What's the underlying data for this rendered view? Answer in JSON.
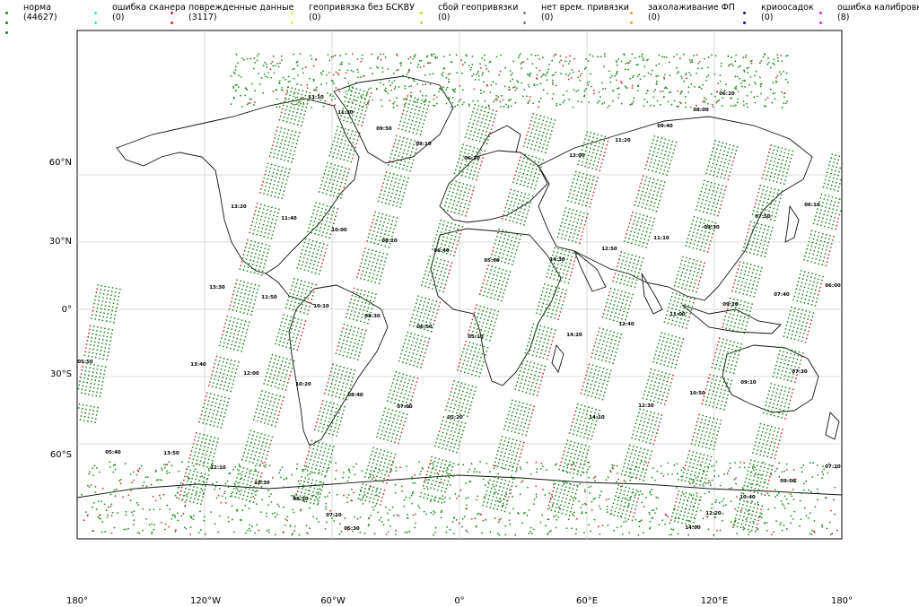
{
  "legend": [
    {
      "label": "норма",
      "count": "(44627)",
      "color": "#1a7a1a"
    },
    {
      "label": "ошибка сканера",
      "count": "(0)",
      "color": "#33e0e0"
    },
    {
      "label": "поврежденные данные",
      "count": "(3117)",
      "color": "#e02020"
    },
    {
      "label": "геопривязка без БСКВУ",
      "count": "(0)",
      "color": "#f0f020"
    },
    {
      "label": "сбой геопривязки",
      "count": "(0)",
      "color": "#b0e020"
    },
    {
      "label": "нет врем. привязки",
      "count": "(0)",
      "color": "#808080"
    },
    {
      "label": "захолаживание ФП",
      "count": "(0)",
      "color": "#f0a020"
    },
    {
      "label": "криоосадок",
      "count": "(0)",
      "color": "#10108a"
    },
    {
      "label": "ошибка калибровки",
      "count": "(8)",
      "color": "#e020e0"
    }
  ],
  "axes": {
    "x_ticks": [
      "180°",
      "120°W",
      "60°W",
      "0°",
      "60°E",
      "120°E",
      "180°"
    ],
    "y_ticks": [
      "60°N",
      "30°N",
      "0°",
      "30°S",
      "60°S"
    ]
  },
  "time_labels": [
    {
      "t": "13:10"
    },
    {
      "t": "11:30"
    },
    {
      "t": "09:50"
    },
    {
      "t": "08:10"
    },
    {
      "t": "06:30"
    },
    {
      "t": "13:00"
    },
    {
      "t": "11:20"
    },
    {
      "t": "09:40"
    },
    {
      "t": "08:00"
    },
    {
      "t": "06:20"
    },
    {
      "t": "13:20"
    },
    {
      "t": "11:40"
    },
    {
      "t": "10:00"
    },
    {
      "t": "08:20"
    },
    {
      "t": "06:40"
    },
    {
      "t": "05:00"
    },
    {
      "t": "14:30"
    },
    {
      "t": "12:50"
    },
    {
      "t": "11:10"
    },
    {
      "t": "09:30"
    },
    {
      "t": "07:50"
    },
    {
      "t": "06:10"
    },
    {
      "t": "13:30"
    },
    {
      "t": "11:50"
    },
    {
      "t": "10:10"
    },
    {
      "t": "08:30"
    },
    {
      "t": "06:50"
    },
    {
      "t": "05:10"
    },
    {
      "t": "14:20"
    },
    {
      "t": "12:40"
    },
    {
      "t": "11:00"
    },
    {
      "t": "09:20"
    },
    {
      "t": "07:40"
    },
    {
      "t": "06:00"
    },
    {
      "t": "05:50"
    },
    {
      "t": "13:40"
    },
    {
      "t": "12:00"
    },
    {
      "t": "10:20"
    },
    {
      "t": "08:40"
    },
    {
      "t": "07:00"
    },
    {
      "t": "05:20"
    },
    {
      "t": "14:10"
    },
    {
      "t": "12:30"
    },
    {
      "t": "10:50"
    },
    {
      "t": "09:10"
    },
    {
      "t": "07:30"
    },
    {
      "t": "05:40"
    },
    {
      "t": "13:50"
    },
    {
      "t": "12:10"
    },
    {
      "t": "10:30"
    },
    {
      "t": "08:50"
    },
    {
      "t": "07:10"
    },
    {
      "t": "05:30"
    },
    {
      "t": "14:00"
    },
    {
      "t": "12:20"
    },
    {
      "t": "10:40"
    },
    {
      "t": "09:00"
    },
    {
      "t": "07:20"
    }
  ]
}
